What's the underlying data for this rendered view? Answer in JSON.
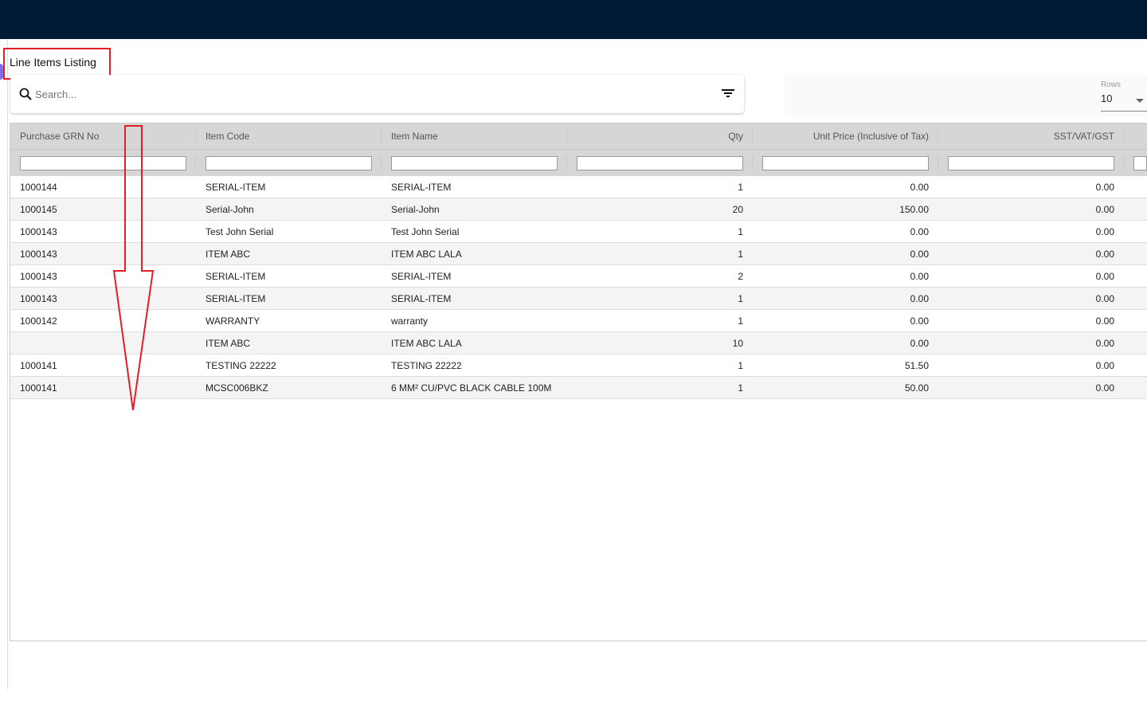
{
  "page": {
    "title": "Line Items Listing"
  },
  "search": {
    "placeholder": "Search..."
  },
  "rows": {
    "label": "Rows",
    "value": "10"
  },
  "columns": [
    "Purchase GRN No",
    "Item Code",
    "Item Name",
    "Qty",
    "Unit Price (Inclusive of Tax)",
    "SST/VAT/GST"
  ],
  "data": [
    [
      "1000144",
      "SERIAL-ITEM",
      "SERIAL-ITEM",
      "1",
      "0.00",
      "0.00"
    ],
    [
      "1000145",
      "Serial-John",
      "Serial-John",
      "20",
      "150.00",
      "0.00"
    ],
    [
      "1000143",
      "Test John Serial",
      "Test John Serial",
      "1",
      "0.00",
      "0.00"
    ],
    [
      "1000143",
      "ITEM ABC",
      "ITEM ABC LALA",
      "1",
      "0.00",
      "0.00"
    ],
    [
      "1000143",
      "SERIAL-ITEM",
      "SERIAL-ITEM",
      "2",
      "0.00",
      "0.00"
    ],
    [
      "1000143",
      "SERIAL-ITEM",
      "SERIAL-ITEM",
      "1",
      "0.00",
      "0.00"
    ],
    [
      "1000142",
      "WARRANTY",
      "warranty",
      "1",
      "0.00",
      "0.00"
    ],
    [
      "",
      "ITEM ABC",
      "ITEM ABC LALA",
      "10",
      "0.00",
      "0.00"
    ],
    [
      "1000141",
      "TESTING 22222",
      "TESTING 22222",
      "1",
      "51.50",
      "0.00"
    ],
    [
      "1000141",
      "MCSC006BKZ",
      "6 MM² CU/PVC BLACK CABLE 100M",
      "1",
      "50.00",
      "0.00"
    ]
  ],
  "colors": {
    "topbar": "#001a35",
    "annotation": "#e41e26"
  }
}
